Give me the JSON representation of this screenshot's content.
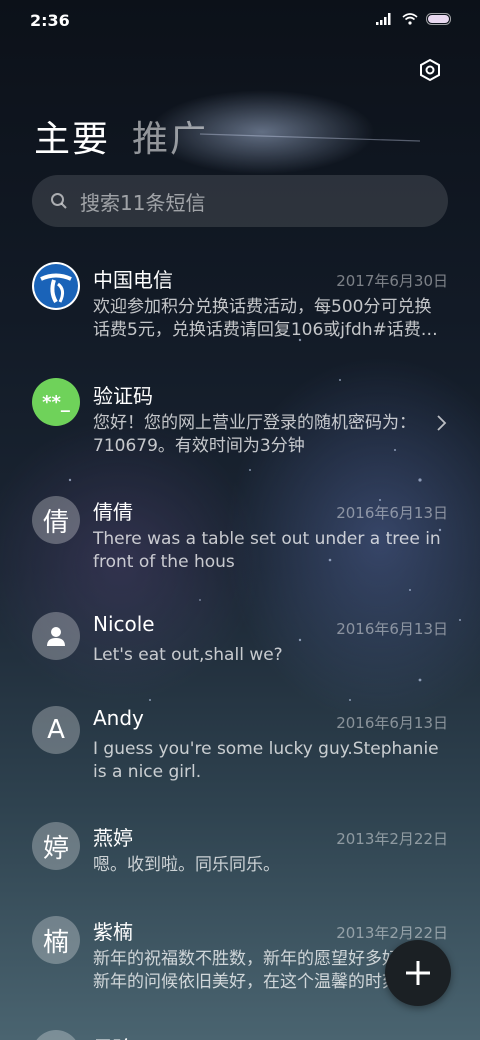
{
  "status": {
    "time": "2:36"
  },
  "tabs": [
    {
      "label": "主要"
    },
    {
      "label": "推广"
    }
  ],
  "search": {
    "placeholder": "搜索11条短信"
  },
  "conversations": [
    {
      "name": "中国电信",
      "date": "2017年6月30日",
      "preview": "欢迎参加积分兑换话费活动，每500分可兑换话费5元，兑换话费请回复106或jfdh#话费…",
      "avatar": "china-telecom-logo"
    },
    {
      "name": "验证码",
      "date": "",
      "preview": "您好！您的网上营业厅登录的随机密码为：710679。有效时间为3分钟",
      "avatar_text": "**_"
    },
    {
      "name": "倩倩",
      "date": "2016年6月13日",
      "preview": "There was a table set out under a tree in front of the hous",
      "avatar_text": "倩"
    },
    {
      "name": "Nicole",
      "date": "2016年6月13日",
      "preview": "Let's eat out,shall we?",
      "avatar": "person-icon"
    },
    {
      "name": "Andy",
      "date": "2016年6月13日",
      "preview": "I guess you're some lucky guy.Stephanie is a nice girl.",
      "avatar_text": "A"
    },
    {
      "name": "燕婷",
      "date": "2013年2月22日",
      "preview": "嗯。收到啦。同乐同乐。",
      "avatar_text": "婷"
    },
    {
      "name": "紫楠",
      "date": "2013年2月22日",
      "preview": "新年的祝福数不胜数，新年的愿望好多好多，新年的问候依旧美好，在这个温馨的时刻",
      "avatar_text": "楠"
    },
    {
      "name": "子玲",
      "date": "",
      "preview": "",
      "avatar_text": "玲"
    }
  ],
  "colors": {
    "verify_badge": "#6fd25a",
    "telecom_blue": "#1a63b8"
  }
}
